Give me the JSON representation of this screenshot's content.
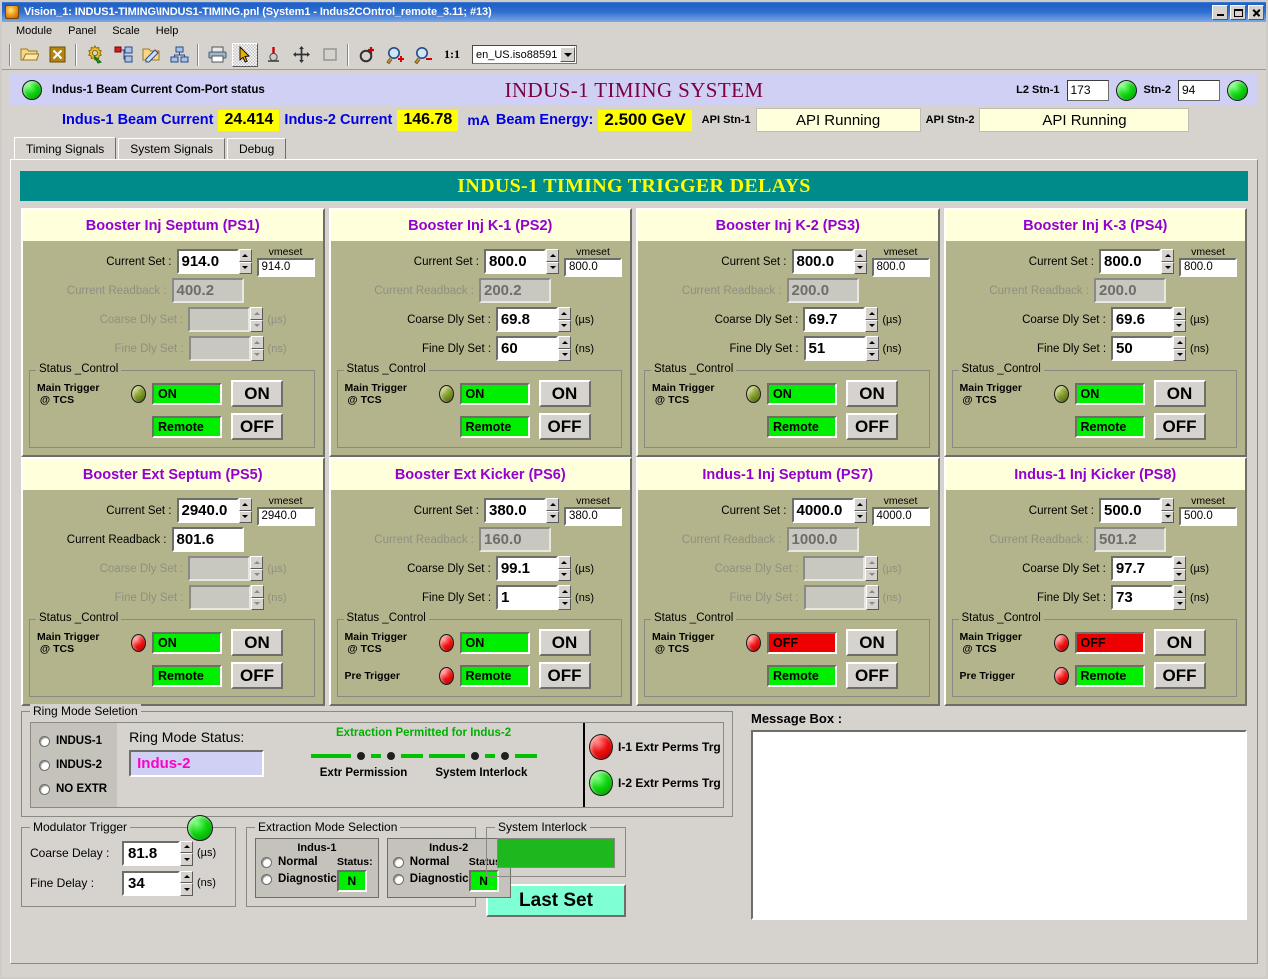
{
  "window": {
    "title": "Vision_1: INDUS1-TIMING\\INDUS1-TIMING.pnl (System1 - Indus2COntrol_remote_3.11; #13)",
    "icon": "app-icon",
    "minimize": "_",
    "maximize": "□",
    "close": "×"
  },
  "menu": {
    "items": [
      "Module",
      "Panel",
      "Scale",
      "Help"
    ]
  },
  "toolbar": {
    "icons": [
      "open-folder-icon",
      "stop-icon",
      "settings-gear-icon",
      "node-tree-icon",
      "edit-folder-icon",
      "hierarchy-icon",
      "print-icon",
      "cursor-arrow-icon",
      "debug-icon",
      "move-icon",
      "rectangle-icon",
      "reference-icon",
      "zoom-in-icon",
      "zoom-out-icon"
    ],
    "scale_label": "1:1",
    "locale": "en_US.iso88591"
  },
  "header": {
    "comport_led": "green",
    "comport_status": "Indus-1 Beam Current Com-Port status",
    "title": "INDUS-1 TIMING SYSTEM",
    "l2_stn1_label": "L2 Stn-1",
    "l2_stn1_value": "173",
    "l2_stn1_led": "green",
    "stn2_label": "Stn-2",
    "stn2_value": "94",
    "stn2_led": "green"
  },
  "currents": {
    "indus1_label": "Indus-1 Beam Current",
    "indus1_value": "24.414",
    "indus2_label": "Indus-2 Current",
    "indus2_value": "146.78",
    "unit": "mA",
    "energy_label": "Beam Energy:",
    "energy_value": "2.500  GeV",
    "api1_label": "API Stn-1",
    "api1_status": "API Running",
    "api2_label": "API Stn-2",
    "api2_status": "API Running"
  },
  "tabs": [
    {
      "label": "Timing Signals",
      "active": true
    },
    {
      "label": "System Signals",
      "active": false
    },
    {
      "label": "Debug",
      "active": false
    }
  ],
  "banner": "INDUS-1  TIMING TRIGGER DELAYS",
  "field_labels": {
    "current_set": "Current Set :",
    "current_readback": "Current Readback :",
    "coarse_dly": "Coarse Dly Set :",
    "fine_dly": "Fine Dly Set :",
    "vmeset": "vmeset",
    "unit_us": "(µs)",
    "unit_ns": "(ns)",
    "status_control": "Status _Control",
    "main_trigger": "Main Trigger",
    "at_tcs": "@ TCS",
    "pre_trigger": "Pre Trigger",
    "on_btn": "ON",
    "off_btn": "OFF",
    "remote": "Remote"
  },
  "panels": [
    {
      "title": "Booster Inj Septum (PS1)",
      "current_set": "914.0",
      "vmeset": "914.0",
      "readback": "400.2",
      "readback_enabled": false,
      "coarse": "",
      "coarse_enabled": false,
      "fine": "",
      "fine_enabled": false,
      "main_trigger_led": "olive",
      "has_pre_trigger": false,
      "pre_trigger_led": "",
      "state": "ON",
      "state_color": "green",
      "mode": "Remote"
    },
    {
      "title": "Booster Inj K-1 (PS2)",
      "current_set": "800.0",
      "vmeset": "800.0",
      "readback": "200.2",
      "readback_enabled": false,
      "coarse": "69.8",
      "coarse_enabled": true,
      "fine": "60",
      "fine_enabled": true,
      "main_trigger_led": "olive",
      "has_pre_trigger": false,
      "pre_trigger_led": "",
      "state": "ON",
      "state_color": "green",
      "mode": "Remote"
    },
    {
      "title": "Booster Inj K-2 (PS3)",
      "current_set": "800.0",
      "vmeset": "800.0",
      "readback": "200.0",
      "readback_enabled": false,
      "coarse": "69.7",
      "coarse_enabled": true,
      "fine": "51",
      "fine_enabled": true,
      "main_trigger_led": "olive",
      "has_pre_trigger": false,
      "pre_trigger_led": "",
      "state": "ON",
      "state_color": "green",
      "mode": "Remote"
    },
    {
      "title": "Booster Inj K-3 (PS4)",
      "current_set": "800.0",
      "vmeset": "800.0",
      "readback": "200.0",
      "readback_enabled": false,
      "coarse": "69.6",
      "coarse_enabled": true,
      "fine": "50",
      "fine_enabled": true,
      "main_trigger_led": "olive",
      "has_pre_trigger": false,
      "pre_trigger_led": "",
      "state": "ON",
      "state_color": "green",
      "mode": "Remote"
    },
    {
      "title": "Booster Ext Septum (PS5)",
      "current_set": "2940.0",
      "vmeset": "2940.0",
      "readback": "801.6",
      "readback_enabled": true,
      "coarse": "",
      "coarse_enabled": false,
      "fine": "",
      "fine_enabled": false,
      "main_trigger_led": "red",
      "has_pre_trigger": false,
      "pre_trigger_led": "",
      "state": "ON",
      "state_color": "green",
      "mode": "Remote"
    },
    {
      "title": "Booster Ext Kicker (PS6)",
      "current_set": "380.0",
      "vmeset": "380.0",
      "readback": "160.0",
      "readback_enabled": false,
      "coarse": "99.1",
      "coarse_enabled": true,
      "fine": "1",
      "fine_enabled": true,
      "main_trigger_led": "red",
      "has_pre_trigger": true,
      "pre_trigger_led": "red",
      "state": "ON",
      "state_color": "green",
      "mode": "Remote"
    },
    {
      "title": "Indus-1 Inj Septum (PS7)",
      "current_set": "4000.0",
      "vmeset": "4000.0",
      "readback": "1000.0",
      "readback_enabled": false,
      "coarse": "",
      "coarse_enabled": false,
      "fine": "",
      "fine_enabled": false,
      "main_trigger_led": "red",
      "has_pre_trigger": false,
      "pre_trigger_led": "",
      "state": "OFF",
      "state_color": "red",
      "mode": "Remote"
    },
    {
      "title": "Indus-1 Inj Kicker (PS8)",
      "current_set": "500.0",
      "vmeset": "500.0",
      "readback": "501.2",
      "readback_enabled": false,
      "coarse": "97.7",
      "coarse_enabled": true,
      "fine": "73",
      "fine_enabled": true,
      "main_trigger_led": "red",
      "has_pre_trigger": true,
      "pre_trigger_led": "red",
      "state": "OFF",
      "state_color": "red",
      "mode": "Remote"
    }
  ],
  "ring_mode": {
    "caption": "Ring Mode Seletion",
    "options": [
      "INDUS-1",
      "INDUS-2",
      "NO EXTR"
    ],
    "status_label": "Ring Mode Status:",
    "status_value": "Indus-2",
    "permit_title": "Extraction Permitted for Indus-2",
    "bar_labels": [
      "Extr Permission",
      "System Interlock"
    ],
    "triggers": [
      {
        "label": "I-1 Extr Perms Trg",
        "led": "red"
      },
      {
        "label": "I-2 Extr Perms Trg",
        "led": "green"
      }
    ]
  },
  "modulator": {
    "caption": "Modulator Trigger",
    "led": "green",
    "coarse_label": "Coarse Delay :",
    "coarse_value": "81.8",
    "coarse_unit": "(µs)",
    "fine_label": "Fine Delay :",
    "fine_value": "34",
    "fine_unit": "(ns)"
  },
  "extraction_mode": {
    "caption": "Extraction Mode Selection",
    "cards": [
      {
        "title": "Indus-1",
        "options": [
          "Normal",
          "Diagnostic"
        ],
        "status_label": "Status:",
        "status_value": "N"
      },
      {
        "title": "Indus-2",
        "options": [
          "Normal",
          "Diagnostic"
        ],
        "status_label": "Status:",
        "status_value": "N"
      }
    ]
  },
  "system_interlock": {
    "caption": "System Interlock",
    "state": "green"
  },
  "last_set": {
    "label": "Last Set"
  },
  "message_box": {
    "caption": "Message Box :",
    "content": ""
  }
}
